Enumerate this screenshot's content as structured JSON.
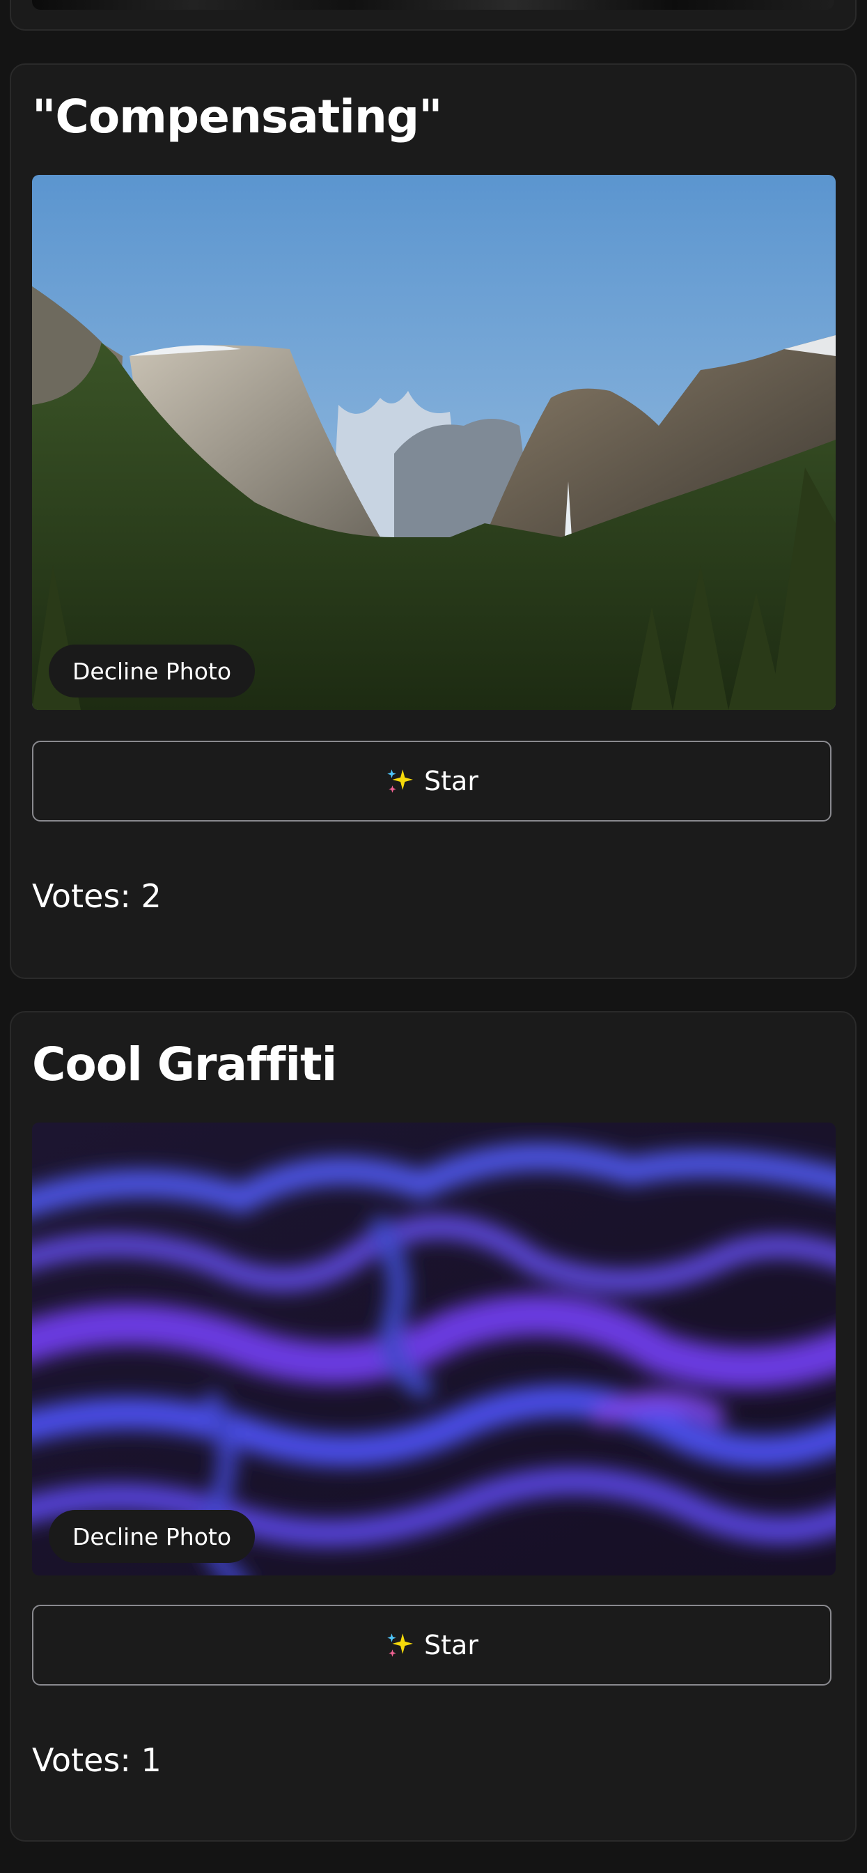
{
  "posts": [
    {
      "title": "\"Compensating\"",
      "image": "mountain-valley-photo",
      "decline_label": "Decline Photo",
      "star_label": "Star",
      "star_icon": "sparkles-icon",
      "votes_text": "Votes: 2"
    },
    {
      "title": "Cool Graffiti",
      "image": "purple-abstract-photo",
      "decline_label": "Decline Photo",
      "star_label": "Star",
      "star_icon": "sparkles-icon",
      "votes_text": "Votes: 1"
    }
  ],
  "colors": {
    "background": "#141414",
    "card": "#1b1b1b",
    "button_border": "#8a8a8f",
    "sparkle": "#f5d90a"
  }
}
